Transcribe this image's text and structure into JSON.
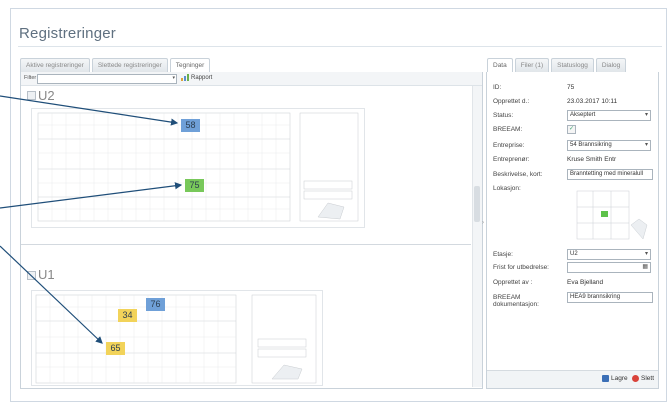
{
  "title": "Registreringer",
  "left_tabs": [
    "Aktive registreringer",
    "Slettede registreringer",
    "Tegninger"
  ],
  "right_tabs": [
    "Data",
    "Filer (1)",
    "Statuslogg",
    "Dialog"
  ],
  "toolbar": {
    "filter_label": "Filter",
    "filter_value": "",
    "rapport_label": "Rapport"
  },
  "floors": [
    {
      "label": "U2",
      "markers": [
        {
          "number": "58",
          "color": "#6fa0d8"
        },
        {
          "number": "75",
          "color": "#78c85a"
        }
      ]
    },
    {
      "label": "U1",
      "markers": [
        {
          "number": "76",
          "color": "#6fa0d8"
        },
        {
          "number": "34",
          "color": "#f2d35a"
        },
        {
          "number": "65",
          "color": "#f2d35a"
        }
      ]
    }
  ],
  "details": {
    "id_label": "ID:",
    "id_value": "75",
    "created_label": "Opprettet d.:",
    "created_value": "23.03.2017 10:11",
    "status_label": "Status:",
    "status_value": "Akseptert",
    "breeam_label": "BREEAM:",
    "breeam_checked": "✓",
    "entreprise_label": "Entreprise:",
    "entreprise_value": "54 Brannsikring",
    "entreprenor_label": "Entreprenør:",
    "entreprenor_value": "Kruse Smith Entr",
    "beskrivelse_label": "Beskrivelse, kort:",
    "beskrivelse_value": "Branntetting med mineralull",
    "lokasjon_label": "Lokasjon:",
    "etasje_label": "Etasje:",
    "etasje_value": "U2",
    "frist_label": "Frist for utbedrelse:",
    "frist_value": "",
    "opprettet_av_label": "Opprettet av :",
    "opprettet_av_value": "Eva Bjelland",
    "breeam_doc_label": "BREEAM dokumentasjon:",
    "breeam_doc_value": "HEA9 brannsikring"
  },
  "footer": {
    "save_label": "Lagre",
    "delete_label": "Slett"
  },
  "colors": {
    "arrow": "#1f4e79",
    "accent": "#5f7080"
  }
}
